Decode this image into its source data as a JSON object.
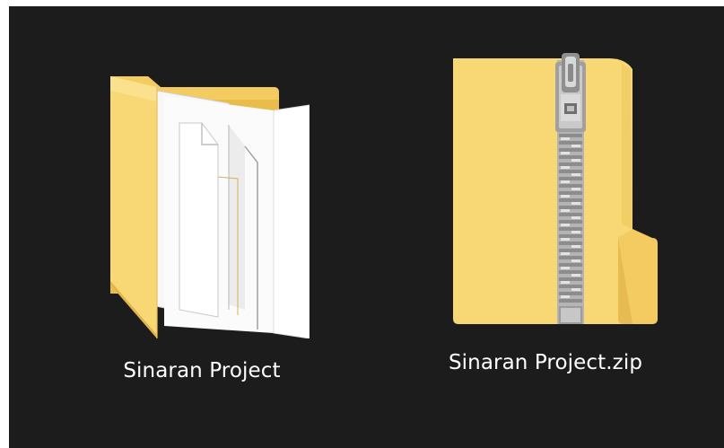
{
  "colors": {
    "pane_background": "#1c1c1c",
    "folder_yellow": "#f8d775",
    "folder_yellow_dark": "#e9bd4c",
    "paper_white": "#ffffff",
    "zipper_gray": "#a7a7a7",
    "label_text": "#ffffff"
  },
  "items": [
    {
      "kind": "folder",
      "icon": "open-folder-with-papers-icon",
      "label": "Sinaran Project"
    },
    {
      "kind": "zip",
      "icon": "zip-folder-icon",
      "label": "Sinaran Project.zip"
    }
  ]
}
